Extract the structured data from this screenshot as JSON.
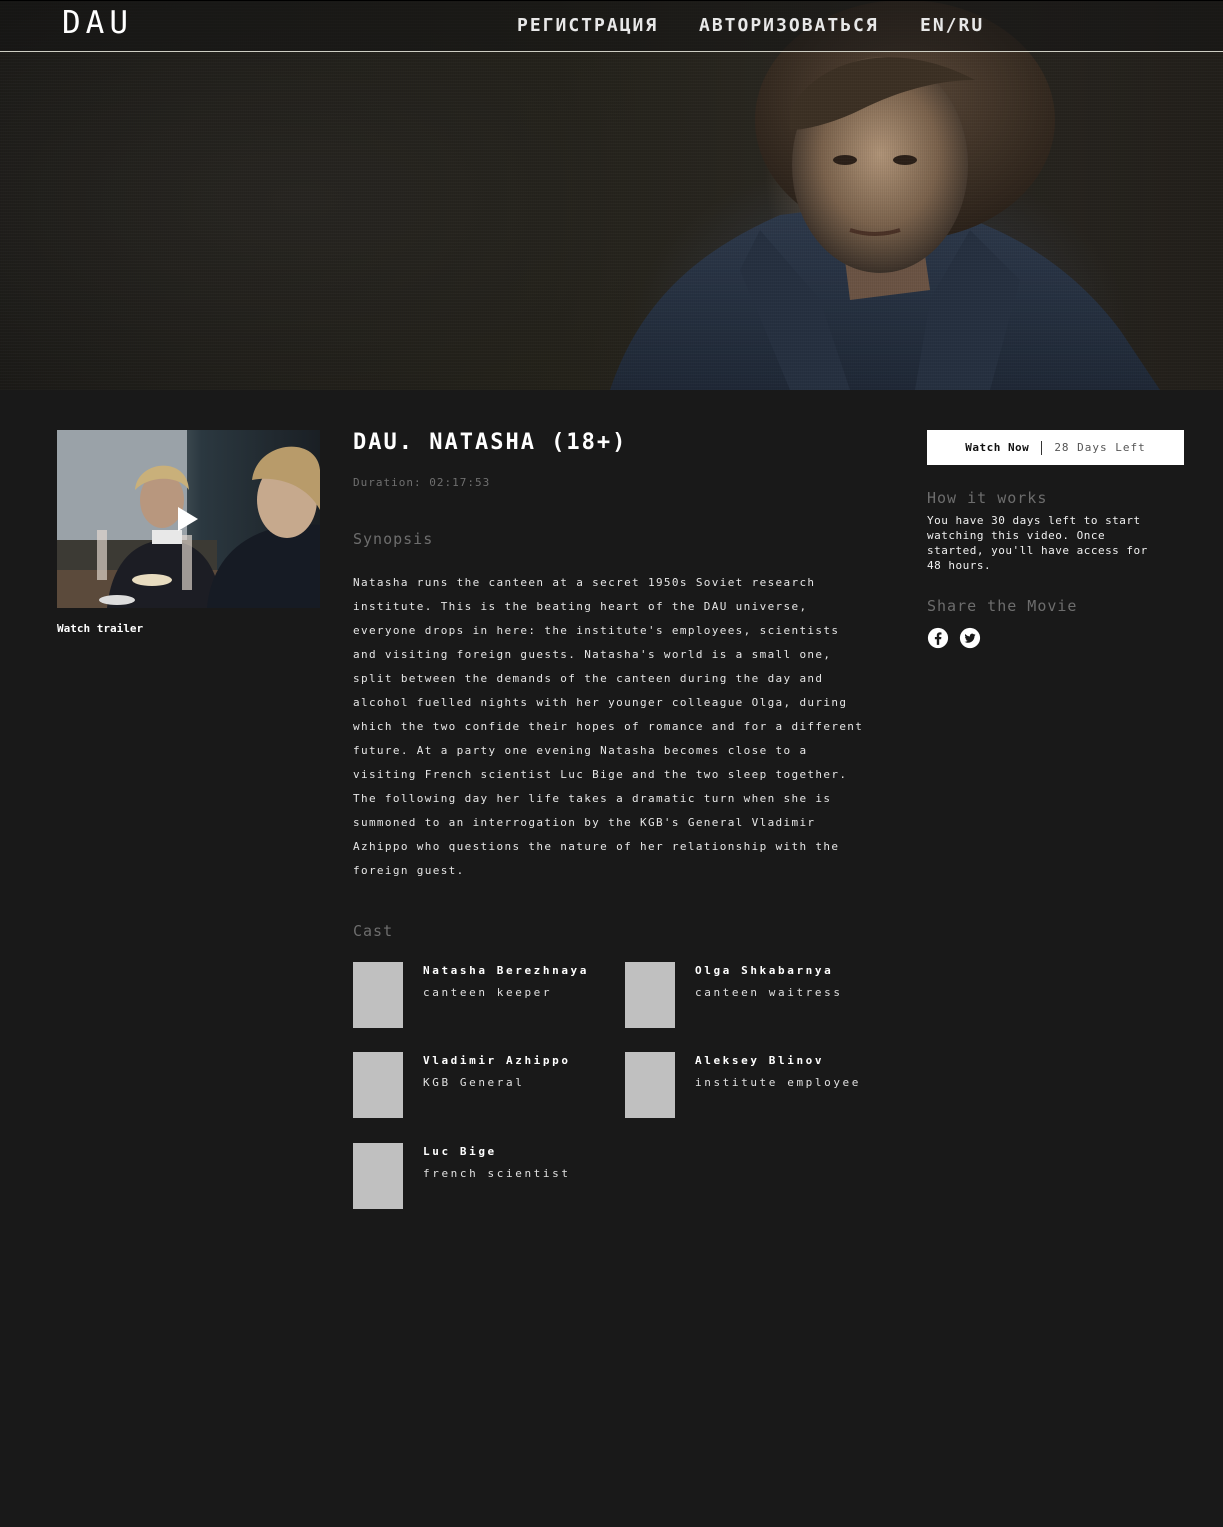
{
  "header": {
    "logo": "DAU",
    "nav": {
      "register": "РЕГИСТРАЦИЯ",
      "login": "АВТОРИЗОВАТЬСЯ",
      "language": "EN/RU"
    }
  },
  "trailer": {
    "label": "Watch trailer"
  },
  "movie": {
    "title": "DAU. NATASHA (18+)",
    "duration": "Duration: 02:17:53",
    "synopsis_heading": "Synopsis",
    "synopsis": "Natasha runs the canteen at a secret 1950s Soviet research institute. This is the beating heart of the DAU universe, everyone drops in here: the institute's employees, scientists and visiting foreign guests. Natasha's world is a small one, split between the demands of the canteen during the day and alcohol fuelled nights with her younger colleague Olga, during which the two confide their hopes of romance and for a different future. At a party one evening Natasha becomes close to a visiting French scientist Luc Bige and the two sleep together. The following day her life takes a dramatic turn when she is summoned to an interrogation by the KGB's General Vladimir Azhippo who questions the nature of her relationship with the foreign guest.",
    "cast_heading": "Cast",
    "cast": [
      {
        "name": "Natasha Berezhnaya",
        "role": "canteen keeper"
      },
      {
        "name": "Olga Shkabarnya",
        "role": "canteen waitress"
      },
      {
        "name": "Vladimir Azhippo",
        "role": "KGB General"
      },
      {
        "name": "Aleksey Blinov",
        "role": "institute employee"
      },
      {
        "name": "Luc Bige",
        "role": "french scientist"
      }
    ]
  },
  "sidebar": {
    "watch_now": "Watch Now",
    "days_left": "28 Days Left",
    "how_heading": "How it works",
    "how_text": "You have 30 days left to start watching this video. Once started, you'll have access for 48 hours.",
    "share_heading": "Share the Movie",
    "share_icons": [
      "facebook-icon",
      "twitter-icon"
    ]
  }
}
